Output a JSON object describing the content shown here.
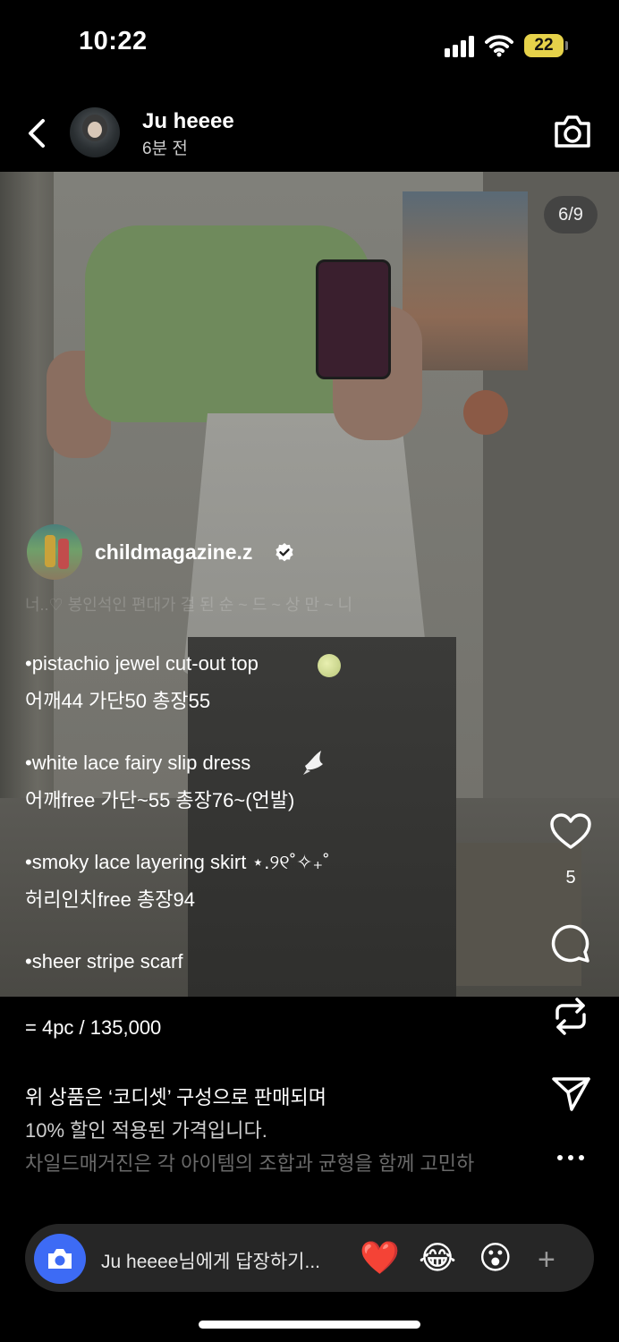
{
  "status": {
    "time": "10:22",
    "battery": "22"
  },
  "header": {
    "username": "Ju heeee",
    "time_ago": "6분 전"
  },
  "photo": {
    "page_indicator": "6/9"
  },
  "caption": {
    "account": "childmagazine.z",
    "faded_line": "너..♡ 봉인석인 편대가 걸 된 순 ~ 드 ~ 상 만 ~ 니",
    "lines": [
      "•pistachio jewel cut-out top",
      "어깨44 가단50 총장55",
      "•white lace fairy slip dress",
      "어깨free 가단~55  총장76~(언발)",
      "•smoky lace layering skirt ⋆.୨୧˚✧₊˚",
      "허리인치free 총장94",
      "•sheer stripe scarf",
      "= 4pc / 135,000",
      "위 상품은 ‘코디셋’ 구성으로 판매되며",
      "10% 할인 적용된 가격입니다.",
      "차일드매거진은 각 아이템의 조합과 균형을 함께 고민하"
    ]
  },
  "actions": {
    "likes": "5"
  },
  "reply": {
    "placeholder": "Ju heeee님에게 답장하기...",
    "emojis": [
      "❤️",
      "😂",
      "😮"
    ],
    "plus": "+"
  },
  "icons": [
    "back-icon",
    "camera-icon",
    "verified-icon",
    "heart-icon",
    "comment-icon",
    "repost-icon",
    "send-icon",
    "more-icon"
  ],
  "colors": {
    "background": "#000000",
    "reply_bar": "#262626",
    "reply_camera": "#3d6bf5",
    "battery": "#e6d24a"
  }
}
